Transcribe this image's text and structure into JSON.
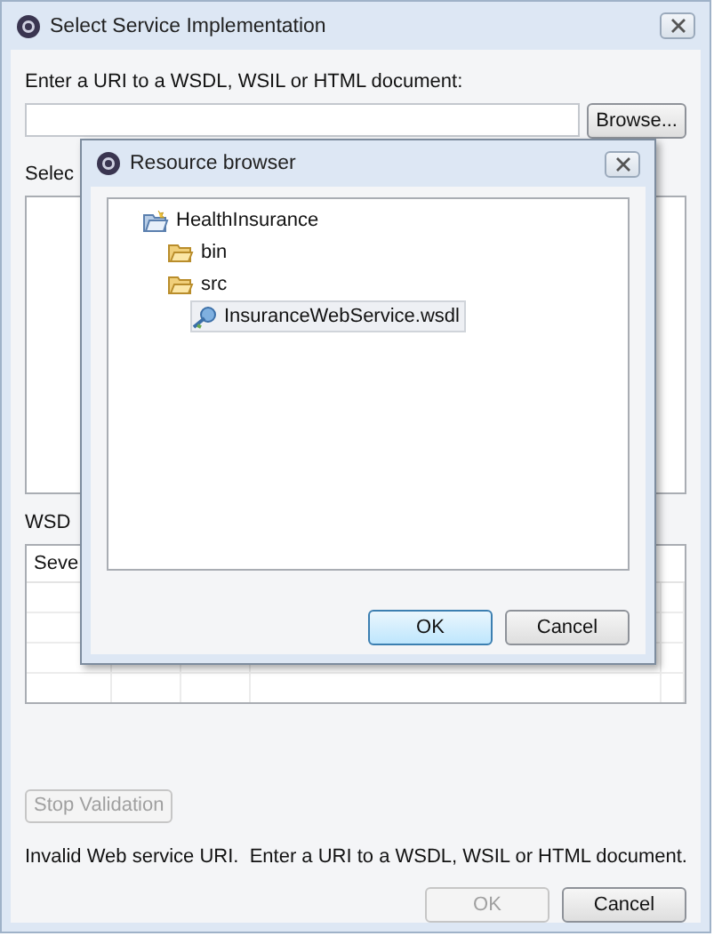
{
  "window": {
    "title": "Select Service Implementation"
  },
  "uri_label": "Enter a URI to a WSDL, WSIL or HTML document:",
  "browse_button": {
    "label": "Browse...",
    "disabled": false
  },
  "select_label": "Selec",
  "wsdl_label": "WSD",
  "table": {
    "columns": [
      "Seve"
    ]
  },
  "stop_button": {
    "label": "Stop Validation",
    "disabled": true
  },
  "status": "Invalid Web service URI.  Enter a URI to a WSDL, WSIL or HTML document.",
  "buttons": [
    {
      "label": "OK",
      "disabled": true
    },
    {
      "label": "Cancel",
      "disabled": false
    }
  ],
  "dialog": {
    "title": "Resource browser",
    "tree": [
      {
        "label": "HealthInsurance",
        "kind": "project",
        "selected": false,
        "children": [
          {
            "label": "bin",
            "kind": "folder",
            "selected": false
          },
          {
            "label": "src",
            "kind": "folder",
            "selected": false,
            "children": [
              {
                "label": "InsuranceWebService.wsdl",
                "kind": "file",
                "selected": true
              }
            ]
          }
        ]
      }
    ],
    "buttons": [
      {
        "label": "OK",
        "default": true
      },
      {
        "label": "Cancel",
        "default": false
      }
    ]
  }
}
